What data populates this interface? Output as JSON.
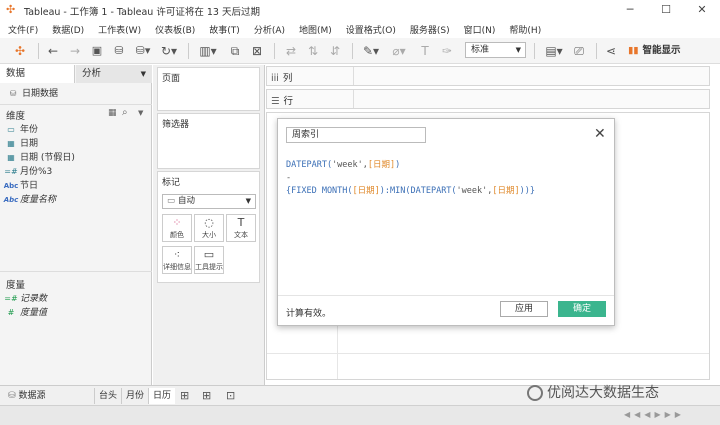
{
  "window": {
    "title": "Tableau - 工作簿 1 - Tableau 许可证将在 13 天后过期",
    "minimize": "─",
    "maximize": "☐",
    "close": "✕"
  },
  "menu": [
    "文件(F)",
    "数据(D)",
    "工作表(W)",
    "仪表板(B)",
    "故事(T)",
    "分析(A)",
    "地图(M)",
    "设置格式(O)",
    "服务器(S)",
    "窗口(N)",
    "帮助(H)"
  ],
  "toolbar": {
    "fit_select": "标准",
    "smart_show": "智能显示"
  },
  "data_pane": {
    "tab_data": "数据",
    "tab_analysis": "分析",
    "datasource": "日期数据",
    "dimensions_header": "维度",
    "dimensions": [
      {
        "icon": "date-icon",
        "label": "年份"
      },
      {
        "icon": "calendar-icon",
        "label": "日期"
      },
      {
        "icon": "calendar-icon",
        "label": "日期 (节假日)"
      },
      {
        "icon": "number-icon",
        "label": "月份%3"
      },
      {
        "icon": "abc-icon",
        "label": "节日"
      },
      {
        "icon": "abc-icon",
        "label": "度量名称"
      }
    ],
    "measures_header": "度量",
    "measures": [
      {
        "icon": "number-icon",
        "label": "记录数"
      },
      {
        "icon": "number-icon",
        "label": "度量值"
      }
    ]
  },
  "cards": {
    "pages": "页面",
    "filters": "筛选器",
    "marks": "标记",
    "mark_type": "自动",
    "mark_buttons": [
      {
        "icon": "color-icon",
        "label": "颜色"
      },
      {
        "icon": "size-icon",
        "label": "大小"
      },
      {
        "icon": "text-icon",
        "label": "文本"
      },
      {
        "icon": "detail-icon",
        "label": "详细信息"
      },
      {
        "icon": "tooltip-icon",
        "label": "工具提示"
      }
    ]
  },
  "shelves": {
    "columns": "列",
    "rows": "行"
  },
  "calc_dialog": {
    "name": "周索引",
    "line1_fn": "DATEPART(",
    "line1_str": "'week'",
    "line1_comma": ",",
    "line1_field": "[日期]",
    "line1_end": ")",
    "line2": "-",
    "line3_a": "{FIXED MONTH(",
    "line3_field1": "[日期]",
    "line3_b": "):MIN(DATEPART(",
    "line3_str": "'week'",
    "line3_comma": ",",
    "line3_field2": "[日期]",
    "line3_end": "))}",
    "status": "计算有效。",
    "apply": "应用",
    "ok": "确定"
  },
  "bottom_tabs": {
    "datasource": "数据源",
    "sheets": [
      "台头",
      "月份",
      "日历"
    ]
  },
  "watermark": "优阅达大数据生态"
}
